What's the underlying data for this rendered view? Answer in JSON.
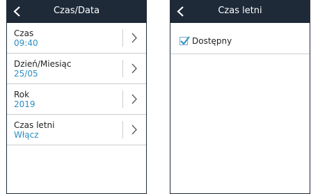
{
  "left_screen": {
    "title": "Czas/Data",
    "items": [
      {
        "label": "Czas",
        "value": "09:40"
      },
      {
        "label": "Dzień/Miesiąc",
        "value": "25/05"
      },
      {
        "label": "Rok",
        "value": "2019"
      },
      {
        "label": "Czas letni",
        "value": "Włącz"
      }
    ]
  },
  "right_screen": {
    "title": "Czas letni",
    "option": {
      "label": "Dostępny",
      "checked": true
    }
  },
  "colors": {
    "header_bg": "#1e2a38",
    "value_text": "#2a8fc4",
    "check": "#2a8fc4"
  },
  "icons": {
    "back": "chevron-left-icon",
    "row_arrow": "chevron-right-icon",
    "check": "checkmark-icon"
  }
}
